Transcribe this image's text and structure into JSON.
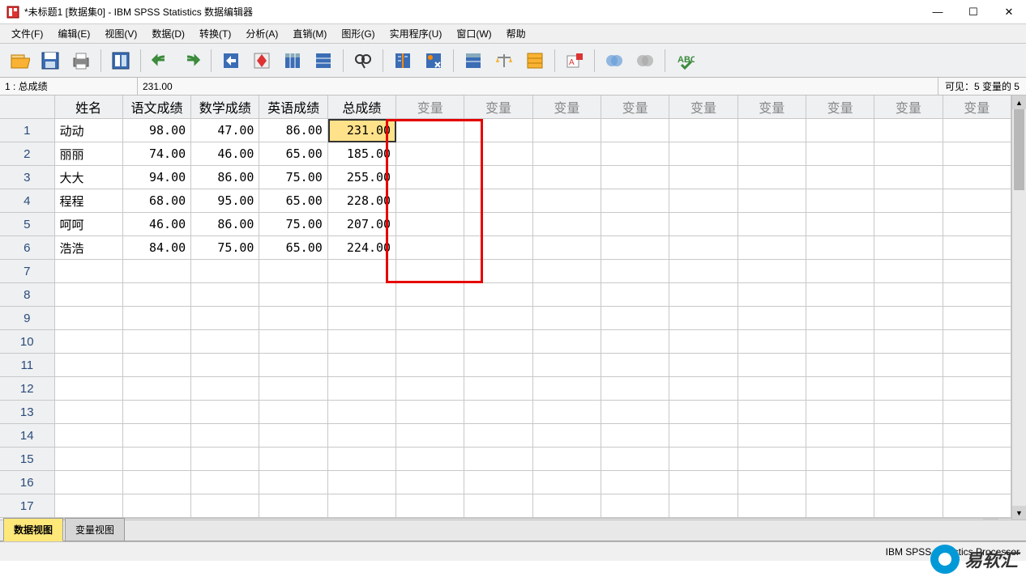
{
  "window": {
    "title": "*未标题1 [数据集0] - IBM SPSS Statistics 数据编辑器"
  },
  "menu": {
    "items": [
      "文件(F)",
      "编辑(E)",
      "视图(V)",
      "数据(D)",
      "转换(T)",
      "分析(A)",
      "直销(M)",
      "图形(G)",
      "实用程序(U)",
      "窗口(W)",
      "帮助"
    ]
  },
  "cellref": {
    "ref": "1 : 总成绩",
    "value": "231.00",
    "visible": "可见：5 变量的 5"
  },
  "columns": [
    "姓名",
    "语文成绩",
    "数学成绩",
    "英语成绩",
    "总成绩"
  ],
  "empty_col": "变量",
  "rows": [
    {
      "n": "1",
      "name": "动动",
      "c1": "98.00",
      "c2": "47.00",
      "c3": "86.00",
      "c4": "231.00"
    },
    {
      "n": "2",
      "name": "丽丽",
      "c1": "74.00",
      "c2": "46.00",
      "c3": "65.00",
      "c4": "185.00"
    },
    {
      "n": "3",
      "name": "大大",
      "c1": "94.00",
      "c2": "86.00",
      "c3": "75.00",
      "c4": "255.00"
    },
    {
      "n": "4",
      "name": "程程",
      "c1": "68.00",
      "c2": "95.00",
      "c3": "65.00",
      "c4": "228.00"
    },
    {
      "n": "5",
      "name": "呵呵",
      "c1": "46.00",
      "c2": "86.00",
      "c3": "75.00",
      "c4": "207.00"
    },
    {
      "n": "6",
      "name": "浩浩",
      "c1": "84.00",
      "c2": "75.00",
      "c3": "65.00",
      "c4": "224.00"
    }
  ],
  "extra_row_numbers": [
    "7",
    "8",
    "9",
    "10",
    "11",
    "12",
    "13",
    "14",
    "15",
    "16",
    "17"
  ],
  "tabs": {
    "data": "数据视图",
    "var": "变量视图"
  },
  "status": {
    "processor": "IBM SPSS Statistics Processor"
  },
  "brand": "易软汇"
}
